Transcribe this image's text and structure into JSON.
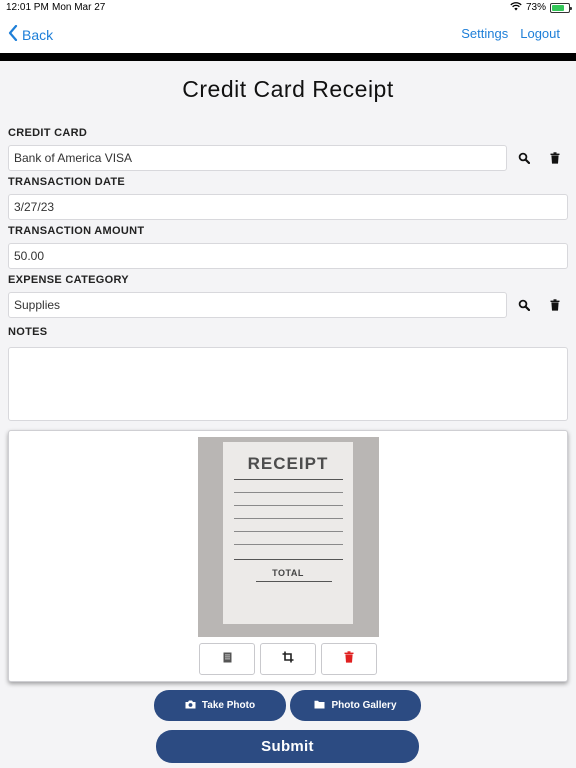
{
  "status_bar": {
    "time": "12:01 PM",
    "date": "Mon Mar 27",
    "battery": "73%",
    "battery_level": 0.73
  },
  "nav": {
    "back_label": "Back",
    "settings_label": "Settings",
    "logout_label": "Logout"
  },
  "page": {
    "title": "Credit Card Receipt"
  },
  "form": {
    "credit_card": {
      "label": "CREDIT CARD",
      "value": "Bank of America VISA"
    },
    "transaction_date": {
      "label": "TRANSACTION DATE",
      "value": "3/27/23"
    },
    "transaction_amount": {
      "label": "TRANSACTION AMOUNT",
      "value": "50.00"
    },
    "expense_category": {
      "label": "EXPENSE CATEGORY",
      "value": "Supplies"
    },
    "notes": {
      "label": "NOTES",
      "value": ""
    }
  },
  "receipt_image": {
    "title": "RECEIPT",
    "total_label": "TOTAL"
  },
  "actions": {
    "take_photo_label": "Take Photo",
    "photo_gallery_label": "Photo Gallery",
    "submit_label": "Submit"
  },
  "colors": {
    "accent": "#1e7fd8",
    "button": "#2c4b82",
    "delete": "#e02020"
  },
  "icons": [
    "wifi-icon",
    "battery-icon",
    "chevron-left-icon",
    "search-icon",
    "trash-icon",
    "document-icon",
    "crop-icon",
    "camera-icon",
    "folder-icon"
  ]
}
